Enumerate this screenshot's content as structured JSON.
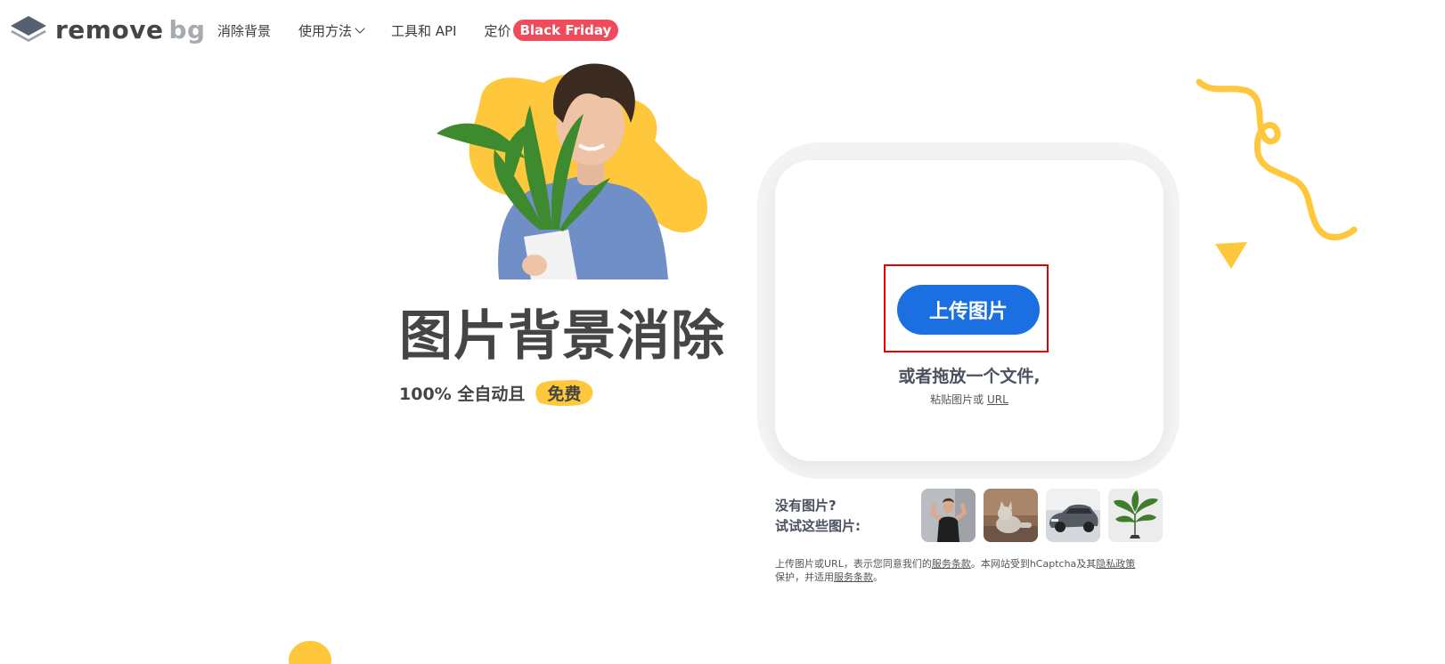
{
  "header": {
    "logo": {
      "word1": "remove",
      "word2": "bg"
    },
    "nav": [
      {
        "label": "消除背景"
      },
      {
        "label": "使用方法"
      },
      {
        "label": "工具和 API"
      },
      {
        "label": "定价"
      }
    ],
    "promo_badge": "Black Friday"
  },
  "hero": {
    "title": "图片背景消除",
    "subtitle": "100% 全自动且",
    "free_label": "免费"
  },
  "upload": {
    "button_label": "上传图片",
    "drop_text": "或者拖放一个文件,",
    "paste_prefix": "粘贴图片或",
    "paste_link": "URL"
  },
  "samples": {
    "line1": "没有图片?",
    "line2": "试试这些图片:",
    "items": [
      "woman-flexing",
      "cat",
      "car",
      "plant"
    ]
  },
  "terms": {
    "part1": "上传图片或URL，表示您同意我们的",
    "link1": "服务条款",
    "part2": "。本网站受到hCaptcha及其",
    "link2": "隐私政策",
    "part3": "保护，并适用",
    "link3": "服务条款",
    "part4": "。"
  },
  "colors": {
    "accent_blue": "#1b6fe0",
    "promo_red": "#ef4c5b",
    "yellow": "#ffc73b",
    "text_dark": "#454545",
    "highlight_red": "#e00000"
  }
}
